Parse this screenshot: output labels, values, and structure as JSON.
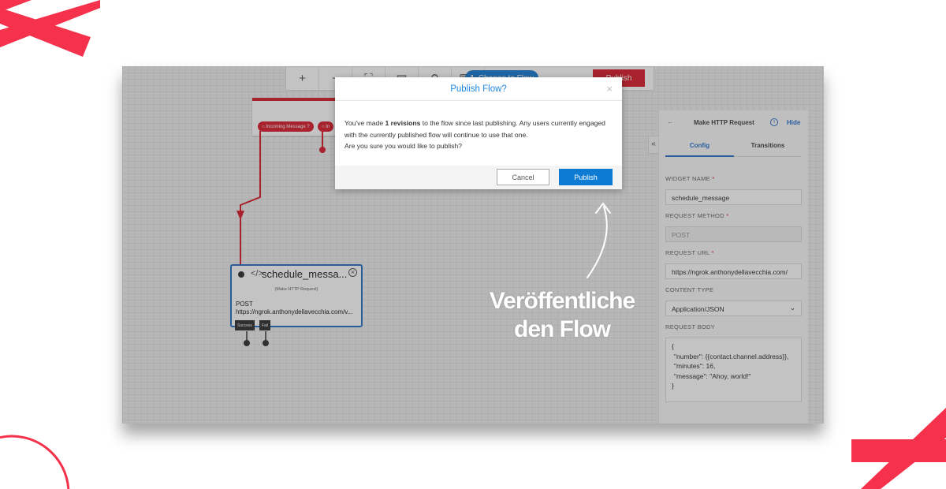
{
  "colors": {
    "accent": "#f5314b",
    "twilio_red": "#d8202e",
    "blue": "#1e7fd6"
  },
  "toolbar": {
    "buttons": [
      "+",
      "−",
      "⛶",
      "▤",
      "⚲",
      "⌨"
    ],
    "changes_count": "1",
    "changes_label": "Change to Flow",
    "publish_label": "Publish"
  },
  "trigger": {
    "pills": [
      "Incoming Message",
      "In"
    ]
  },
  "node": {
    "title": "schedule_messa...",
    "subtitle": "(Make HTTP Request)",
    "method": "POST",
    "url": "https://ngrok.anthonydellavecchia.com/v...",
    "transitions": [
      "Success",
      "Fail"
    ]
  },
  "panel": {
    "back": "←",
    "title": "Make HTTP Request",
    "hide": "Hide",
    "collapse": "«",
    "tabs": [
      {
        "label": "Config",
        "active": true
      },
      {
        "label": "Transitions",
        "active": false
      }
    ],
    "widget_name_label": "WIDGET NAME",
    "widget_name": "schedule_message",
    "method_label": "REQUEST METHOD",
    "method": "POST",
    "url_label": "REQUEST URL",
    "url": "https://ngrok.anthonydellavecchia.com/",
    "content_type_label": "CONTENT TYPE",
    "content_type": "Application/JSON",
    "body_label": "REQUEST BODY",
    "body_lines": [
      "{",
      "\"number\": {{contact.channel.address}},",
      "\"minutes\": 16,",
      "\"message\": \"Ahoy, world!\"",
      "}"
    ],
    "required": "*"
  },
  "modal": {
    "title": "Publish Flow?",
    "close": "×",
    "text_pre": "You've made ",
    "text_bold": "1 revisions",
    "text_post": " to the flow since last publishing. Any users currently engaged with the currently published flow will continue to use that one.",
    "question": "Are you sure you would like to publish?",
    "cancel": "Cancel",
    "publish": "Publish"
  },
  "annotation": {
    "line1": "Veröffentliche",
    "line2": "den Flow"
  }
}
